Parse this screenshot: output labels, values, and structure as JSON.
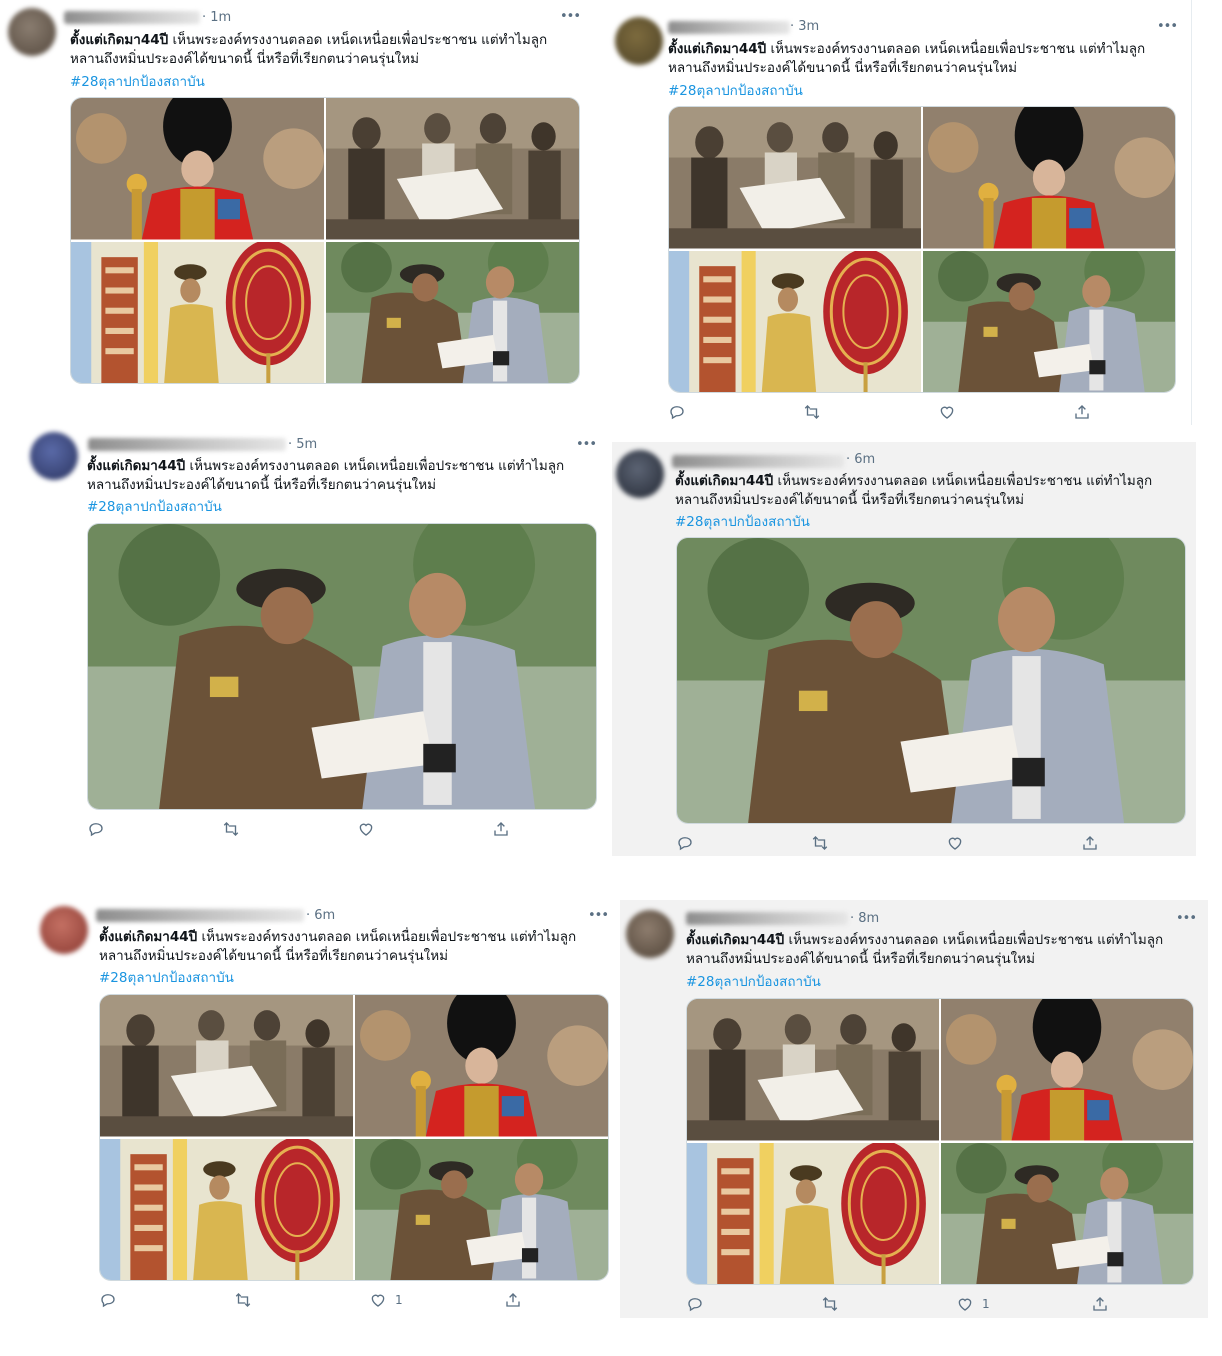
{
  "tweet_text_bold": "ตั้งแต่เกิดมา44ปี",
  "tweet_text_line1_rest": " เห็นพระองค์ทรงงานตลอด เหน็ดเหนื่อยเพื่อประชาชน แต่ทำไมลูก",
  "tweet_text_line2": "หลานถึงหมิ่นประองค์ได้ขนาดนี้ นี่หรือที่เรียกตนว่าคนรุ่นใหม่",
  "hashtag": "#28ตุลาปกป้องสถาบัน",
  "more_icon": "more-horizontal-icon",
  "tweets": [
    {
      "time": "· 1m",
      "likes": ""
    },
    {
      "time": "· 3m",
      "likes": ""
    },
    {
      "time": "· 5m",
      "likes": ""
    },
    {
      "time": "· 6m",
      "likes": ""
    },
    {
      "time": "· 6m",
      "likes": "1"
    },
    {
      "time": "· 8m",
      "likes": "1"
    }
  ],
  "icons": {
    "reply": "reply-icon",
    "retweet": "retweet-icon",
    "like": "like-icon",
    "share": "share-icon"
  },
  "colors": {
    "hashtag": "#1b95e0",
    "meta": "#5b7083",
    "gray_background": "#f2f2f2"
  }
}
